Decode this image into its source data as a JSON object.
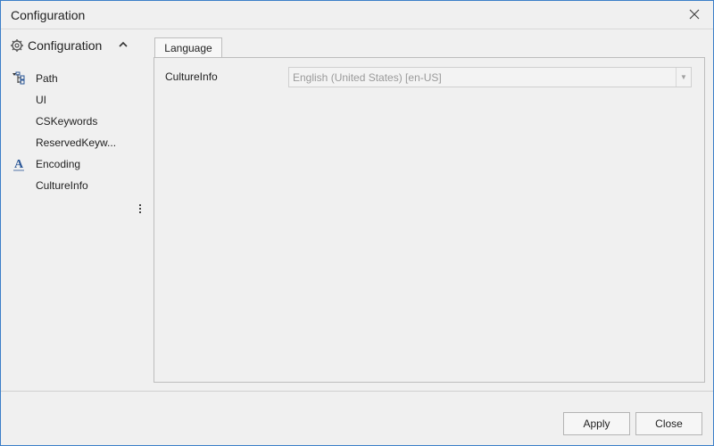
{
  "window": {
    "title": "Configuration",
    "close_icon": "close-icon"
  },
  "sidebar": {
    "header": {
      "label": "Configuration",
      "icon": "gear-icon",
      "toggle_icon": "chevron-up-icon"
    },
    "items": [
      {
        "label": "Path",
        "icon": "tree-icon"
      },
      {
        "label": "UI",
        "icon": ""
      },
      {
        "label": "CSKeywords",
        "icon": ""
      },
      {
        "label": "ReservedKeyw...",
        "icon": ""
      },
      {
        "label": "Encoding",
        "icon": "font-icon"
      },
      {
        "label": "CultureInfo",
        "icon": ""
      }
    ],
    "more_icon": "vertical-dots-icon"
  },
  "main": {
    "tabs": [
      {
        "label": "Language"
      }
    ],
    "fields": [
      {
        "label": "CultureInfo",
        "value": "English (United States) [en-US]"
      }
    ]
  },
  "footer": {
    "apply_label": "Apply",
    "close_label": "Close"
  },
  "colors": {
    "window_border": "#3c7fc8",
    "background": "#f0f0f0",
    "disabled_text": "#9a9a9a",
    "icon_blue": "#2b5797"
  }
}
